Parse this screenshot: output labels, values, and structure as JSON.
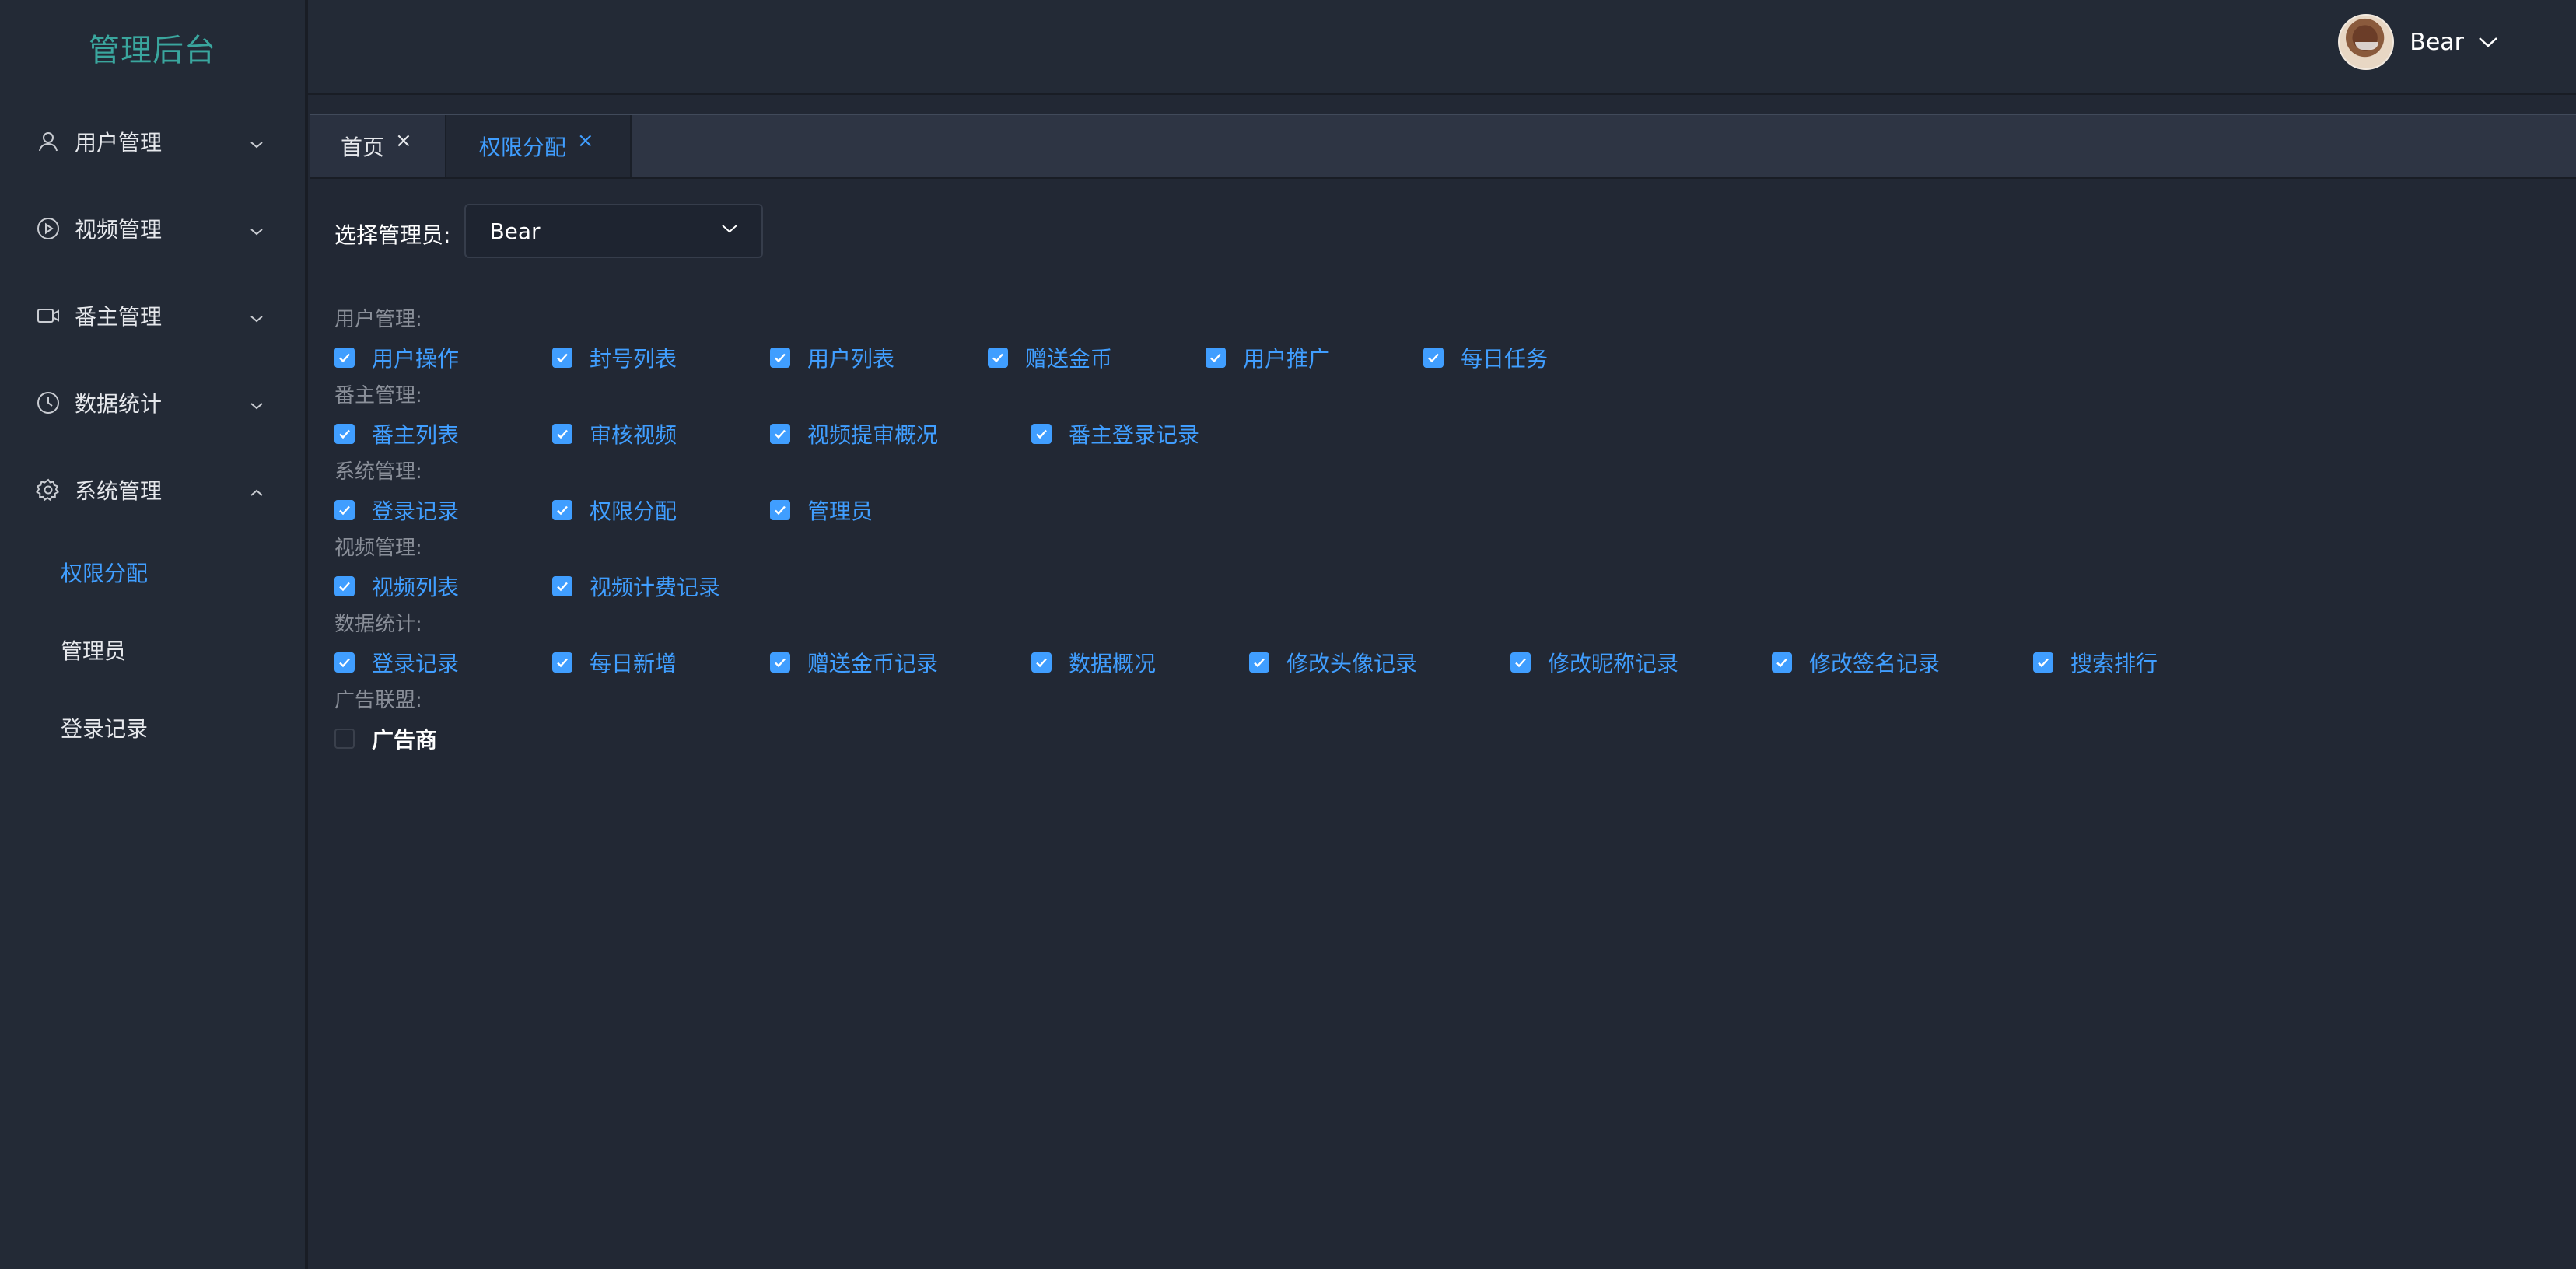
{
  "logo": "管理后台",
  "sidebar": {
    "menus": [
      {
        "label": "用户管理",
        "icon": "user-icon"
      },
      {
        "label": "视频管理",
        "icon": "play-circle-icon"
      },
      {
        "label": "番主管理",
        "icon": "video-camera-icon"
      },
      {
        "label": "数据统计",
        "icon": "clock-icon"
      },
      {
        "label": "系统管理",
        "icon": "gear-icon"
      }
    ],
    "submenu": [
      {
        "label": "权限分配",
        "active": true
      },
      {
        "label": "管理员"
      },
      {
        "label": "登录记录"
      }
    ]
  },
  "header": {
    "user_name": "Bear"
  },
  "tabs": [
    {
      "label": "首页",
      "close": "×"
    },
    {
      "label": "权限分配",
      "close": "×",
      "active": true
    }
  ],
  "form": {
    "select_label": "选择管理员:",
    "select_value": "Bear"
  },
  "groups": [
    {
      "title": "用户管理:",
      "items": [
        "用户操作",
        "封号列表",
        "用户列表",
        "赠送金币",
        "用户推广",
        "每日任务"
      ]
    },
    {
      "title": "番主管理:",
      "items": [
        "番主列表",
        "审核视频",
        "视频提审概况",
        "番主登录记录"
      ]
    },
    {
      "title": "系统管理:",
      "items": [
        "登录记录",
        "权限分配",
        "管理员"
      ]
    },
    {
      "title": "视频管理:",
      "items": [
        "视频列表",
        "视频计费记录"
      ]
    },
    {
      "title": "数据统计:",
      "items": [
        "登录记录",
        "每日新增",
        "赠送金币记录",
        "数据概况",
        "修改头像记录",
        "修改昵称记录",
        "修改签名记录",
        "搜索排行"
      ]
    },
    {
      "title": "广告联盟:",
      "items": [
        "广告商"
      ],
      "unchecked": true
    }
  ],
  "colors": {
    "accent": "#409eff",
    "logo": "#3aa69e",
    "background": "#222834",
    "sidebar": "#232a36"
  }
}
